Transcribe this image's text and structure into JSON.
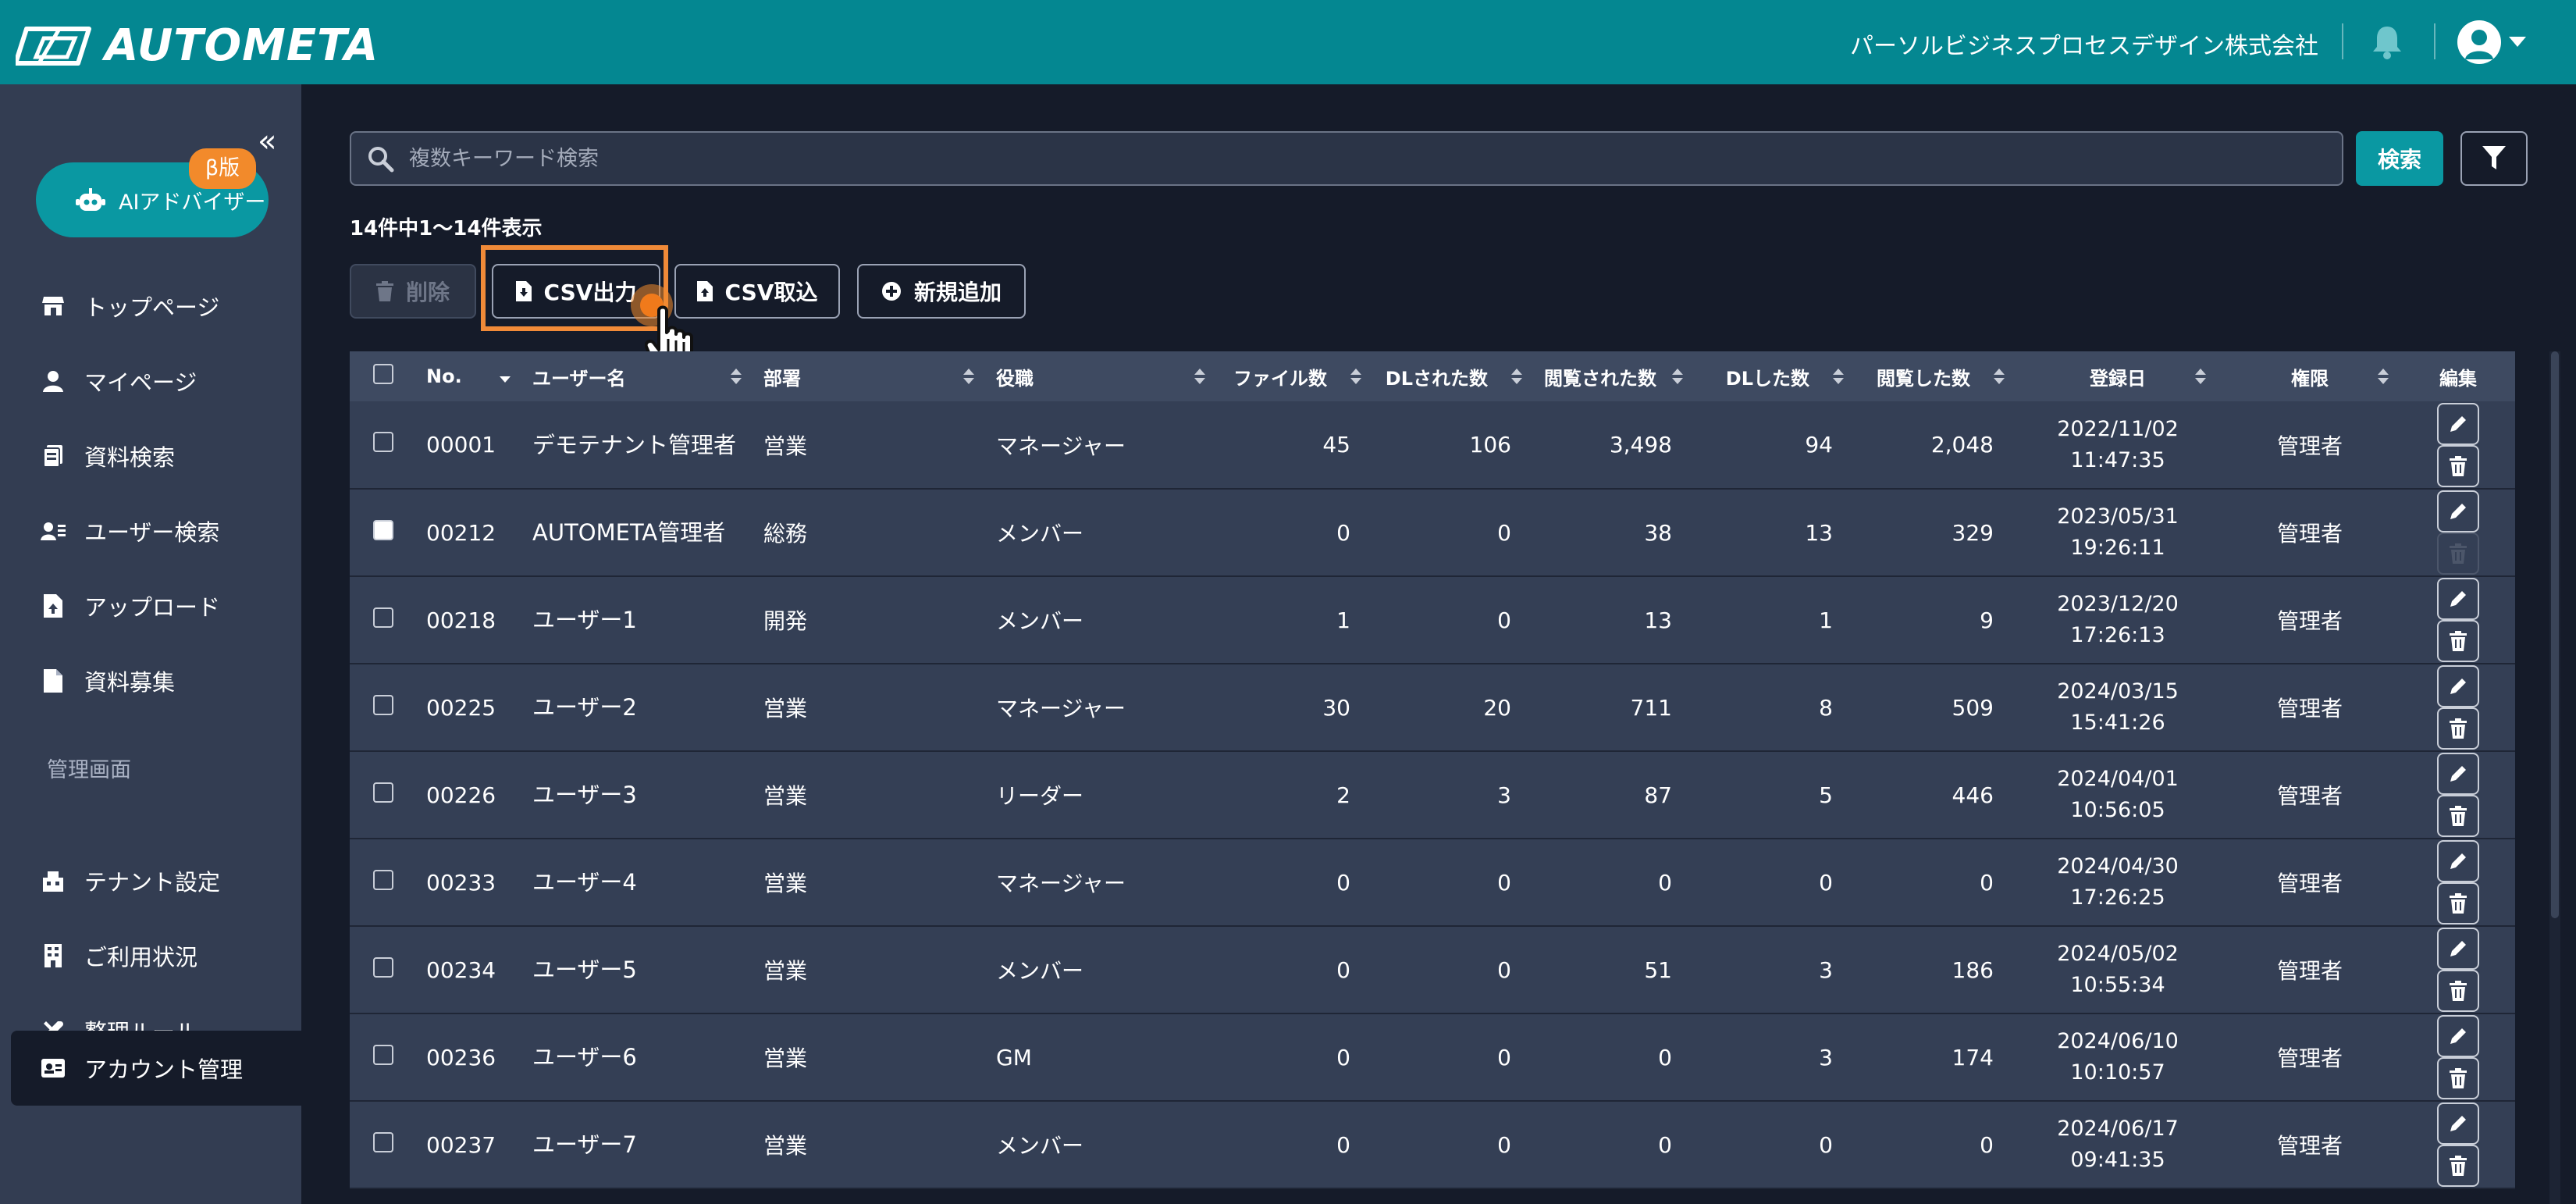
{
  "header": {
    "brand": "AUTOMETA",
    "company": "パーソルビジネスプロセスデザイン株式会社"
  },
  "sidebar": {
    "collapse_glyph": "«",
    "ai_button": "AIアドバイザー",
    "beta_badge": "β版",
    "section_admin": "管理画面",
    "items": [
      {
        "label": "トップページ",
        "icon": "store-icon"
      },
      {
        "label": "マイページ",
        "icon": "user-icon"
      },
      {
        "label": "資料検索",
        "icon": "document-search-icon"
      },
      {
        "label": "ユーザー検索",
        "icon": "user-search-icon"
      },
      {
        "label": "アップロード",
        "icon": "file-upload-icon"
      },
      {
        "label": "資料募集",
        "icon": "file-icon"
      },
      {
        "label": "テナント設定",
        "icon": "tenant-icon"
      },
      {
        "label": "ご利用状況",
        "icon": "building-icon"
      },
      {
        "label": "整理ルール",
        "icon": "tools-icon"
      },
      {
        "label": "アカウント管理",
        "icon": "id-card-icon",
        "active": true
      }
    ]
  },
  "search": {
    "placeholder": "複数キーワード検索",
    "value": "",
    "button": "検索"
  },
  "results_count": "14件中1〜14件表示",
  "toolbar": {
    "delete": "削除",
    "csv_export": "CSV出力",
    "csv_import": "CSV取込",
    "add_new": "新規追加"
  },
  "table": {
    "headers": {
      "no": "No.",
      "user": "ユーザー名",
      "dept": "部署",
      "role": "役職",
      "files": "ファイル数",
      "dl_received": "DLされた数",
      "views_received": "閲覧された数",
      "dl_done": "DLした数",
      "views_done": "閲覧した数",
      "registered": "登録日",
      "perm": "権限",
      "edit": "編集"
    },
    "rows": [
      {
        "no": "00001",
        "user": "デモテナント管理者",
        "dept": "営業",
        "role": "マネージャー",
        "files": "45",
        "dlr": "106",
        "vr": "3,498",
        "dl": "94",
        "v": "2,048",
        "date": "2022/11/02",
        "time": "11:47:35",
        "perm": "管理者",
        "checkbox_white": false,
        "delete_disabled": false
      },
      {
        "no": "00212",
        "user": "AUTOMETA管理者",
        "dept": "総務",
        "role": "メンバー",
        "files": "0",
        "dlr": "0",
        "vr": "38",
        "dl": "13",
        "v": "329",
        "date": "2023/05/31",
        "time": "19:26:11",
        "perm": "管理者",
        "checkbox_white": true,
        "delete_disabled": true
      },
      {
        "no": "00218",
        "user": "ユーザー1",
        "dept": "開発",
        "role": "メンバー",
        "files": "1",
        "dlr": "0",
        "vr": "13",
        "dl": "1",
        "v": "9",
        "date": "2023/12/20",
        "time": "17:26:13",
        "perm": "管理者",
        "checkbox_white": false,
        "delete_disabled": false
      },
      {
        "no": "00225",
        "user": "ユーザー2",
        "dept": "営業",
        "role": "マネージャー",
        "files": "30",
        "dlr": "20",
        "vr": "711",
        "dl": "8",
        "v": "509",
        "date": "2024/03/15",
        "time": "15:41:26",
        "perm": "管理者",
        "checkbox_white": false,
        "delete_disabled": false
      },
      {
        "no": "00226",
        "user": "ユーザー3",
        "dept": "営業",
        "role": "リーダー",
        "files": "2",
        "dlr": "3",
        "vr": "87",
        "dl": "5",
        "v": "446",
        "date": "2024/04/01",
        "time": "10:56:05",
        "perm": "管理者",
        "checkbox_white": false,
        "delete_disabled": false
      },
      {
        "no": "00233",
        "user": "ユーザー4",
        "dept": "営業",
        "role": "マネージャー",
        "files": "0",
        "dlr": "0",
        "vr": "0",
        "dl": "0",
        "v": "0",
        "date": "2024/04/30",
        "time": "17:26:25",
        "perm": "管理者",
        "checkbox_white": false,
        "delete_disabled": false
      },
      {
        "no": "00234",
        "user": "ユーザー5",
        "dept": "営業",
        "role": "メンバー",
        "files": "0",
        "dlr": "0",
        "vr": "51",
        "dl": "3",
        "v": "186",
        "date": "2024/05/02",
        "time": "10:55:34",
        "perm": "管理者",
        "checkbox_white": false,
        "delete_disabled": false
      },
      {
        "no": "00236",
        "user": "ユーザー6",
        "dept": "営業",
        "role": "GM",
        "files": "0",
        "dlr": "0",
        "vr": "0",
        "dl": "3",
        "v": "174",
        "date": "2024/06/10",
        "time": "10:10:57",
        "perm": "管理者",
        "checkbox_white": false,
        "delete_disabled": false
      },
      {
        "no": "00237",
        "user": "ユーザー7",
        "dept": "営業",
        "role": "メンバー",
        "files": "0",
        "dlr": "0",
        "vr": "0",
        "dl": "0",
        "v": "0",
        "date": "2024/06/17",
        "time": "09:41:35",
        "perm": "管理者",
        "checkbox_white": false,
        "delete_disabled": false
      }
    ]
  },
  "colors": {
    "header": "#048791",
    "accent": "#0a98a2",
    "beta": "#f28a2b",
    "highlight": "#f08a38",
    "background": "#151b29",
    "sidebar": "#333d52"
  }
}
